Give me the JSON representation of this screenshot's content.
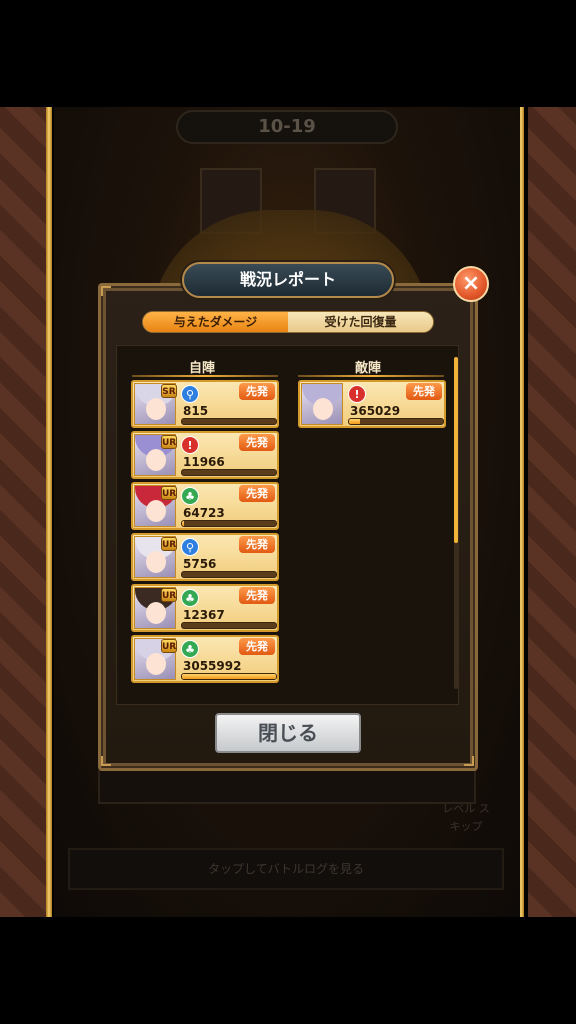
{
  "scene": {
    "stage": "10-19",
    "footer_hint": "タップしてバトルログを見る",
    "badge_text": "レベル スキップ"
  },
  "dialog": {
    "title": "戦況レポート",
    "close_icon": "×",
    "tabs": [
      {
        "label": "与えたダメージ",
        "active": true
      },
      {
        "label": "受けた回復量",
        "active": false
      }
    ],
    "ally_header": "自陣",
    "enemy_header": "敵陣",
    "close_button": "閉じる"
  },
  "allies": [
    {
      "rank": "SR",
      "attribute": "blue",
      "attribute_icon": "sword-blue-icon",
      "badge": "先発",
      "value": "815",
      "fill": 0.0
    },
    {
      "rank": "UR",
      "attribute": "red",
      "attribute_icon": "sword-red-icon",
      "badge": "先発",
      "value": "11966",
      "fill": 0.0
    },
    {
      "rank": "UR",
      "attribute": "green",
      "attribute_icon": "tree-green-icon",
      "badge": "先発",
      "value": "64723",
      "fill": 0.02
    },
    {
      "rank": "UR",
      "attribute": "blue",
      "attribute_icon": "sword-blue-icon",
      "badge": "先発",
      "value": "5756",
      "fill": 0.0
    },
    {
      "rank": "UR",
      "attribute": "green",
      "attribute_icon": "tree-green-icon",
      "badge": "先発",
      "value": "12367",
      "fill": 0.0
    },
    {
      "rank": "UR",
      "attribute": "green",
      "attribute_icon": "tree-green-icon",
      "badge": "先発",
      "value": "3055992",
      "fill": 1.0
    }
  ],
  "enemies": [
    {
      "rank": "",
      "attribute": "red",
      "attribute_icon": "sword-red-icon",
      "badge": "先発",
      "value": "365029",
      "fill": 0.12
    }
  ],
  "colors": {
    "accent": "#f3b23a",
    "badge": "#e15a12",
    "close": "#e2572a"
  }
}
